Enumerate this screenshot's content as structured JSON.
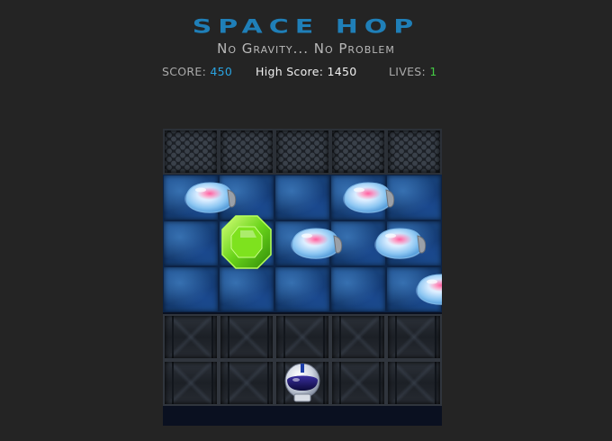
{
  "game": {
    "title": "SPACE HOP",
    "subtitle": "No Gravity... No Problem"
  },
  "hud": {
    "score_label": "SCORE:",
    "score_value": "450",
    "high_score_label": "High Score:",
    "high_score_value": "1450",
    "lives_label": "LIVES:",
    "lives_value": "1"
  },
  "board": {
    "columns": 5,
    "rows": [
      {
        "type": "hex-wall"
      },
      {
        "type": "water"
      },
      {
        "type": "water"
      },
      {
        "type": "water"
      },
      {
        "type": "metal-floor"
      },
      {
        "type": "metal-floor"
      }
    ],
    "sprites": [
      {
        "kind": "jellyfish-enemy",
        "row": 1,
        "col": 0.35
      },
      {
        "kind": "jellyfish-enemy",
        "row": 1,
        "col": 3.2
      },
      {
        "kind": "jellyfish-enemy",
        "row": 2,
        "col": 2.25
      },
      {
        "kind": "jellyfish-enemy",
        "row": 2,
        "col": 3.75
      },
      {
        "kind": "jellyfish-enemy",
        "row": 3,
        "col": 4.5
      },
      {
        "kind": "green-gem",
        "row": 2,
        "col": 1
      },
      {
        "kind": "astronaut-player",
        "row": 5,
        "col": 2
      }
    ]
  },
  "colors": {
    "background": "#242424",
    "title": "#1f7fb8",
    "score_value": "#2aa3e0",
    "lives_value": "#44cc44"
  }
}
